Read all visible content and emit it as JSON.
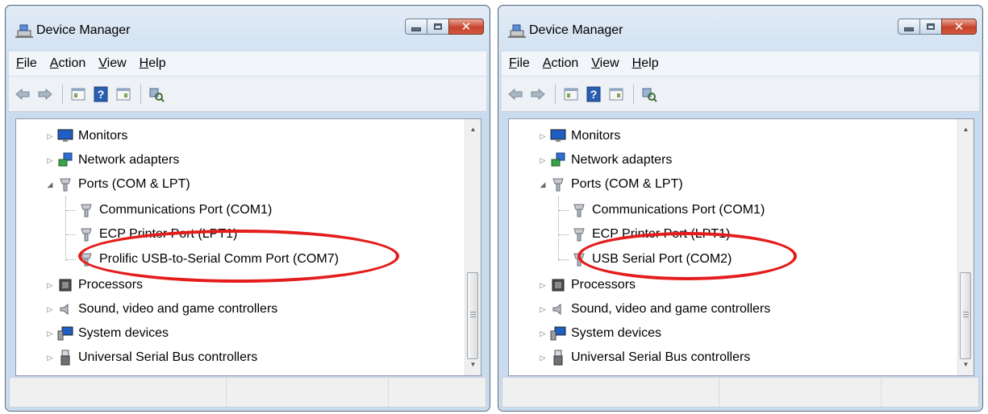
{
  "colors": {
    "highlight": "#e41c1c",
    "title_bar": "#d2e1f1",
    "close_button": "#c7442c"
  },
  "windows": [
    {
      "title": "Device Manager",
      "menu": [
        {
          "accel": "F",
          "rest": "ile"
        },
        {
          "accel": "A",
          "rest": "ction"
        },
        {
          "accel": "V",
          "rest": "iew"
        },
        {
          "accel": "H",
          "rest": "elp"
        }
      ],
      "toolbar_icons": [
        "back-arrow-icon",
        "forward-arrow-icon",
        "properties-icon",
        "help-icon",
        "update-driver-icon",
        "scan-hardware-icon"
      ],
      "tree": {
        "monitors": "Monitors",
        "network": "Network adapters",
        "ports": "Ports (COM & LPT)",
        "port_children": [
          "Communications Port (COM1)",
          "ECP Printer Port (LPT1)",
          "Prolific USB-to-Serial Comm Port (COM7)"
        ],
        "processors": "Processors",
        "sound": "Sound, video and game controllers",
        "system": "System devices",
        "usb": "Universal Serial Bus controllers"
      },
      "highlighted": "Prolific USB-to-Serial Comm Port (COM7)"
    },
    {
      "title": "Device Manager",
      "menu": [
        {
          "accel": "F",
          "rest": "ile"
        },
        {
          "accel": "A",
          "rest": "ction"
        },
        {
          "accel": "V",
          "rest": "iew"
        },
        {
          "accel": "H",
          "rest": "elp"
        }
      ],
      "toolbar_icons": [
        "back-arrow-icon",
        "forward-arrow-icon",
        "properties-icon",
        "help-icon",
        "update-driver-icon",
        "scan-hardware-icon"
      ],
      "tree": {
        "monitors": "Monitors",
        "network": "Network adapters",
        "ports": "Ports (COM & LPT)",
        "port_children": [
          "Communications Port (COM1)",
          "ECP Printer Port (LPT1)",
          "USB Serial Port (COM2)"
        ],
        "processors": "Processors",
        "sound": "Sound, video and game controllers",
        "system": "System devices",
        "usb": "Universal Serial Bus controllers"
      },
      "highlighted": "USB Serial Port (COM2)"
    }
  ]
}
